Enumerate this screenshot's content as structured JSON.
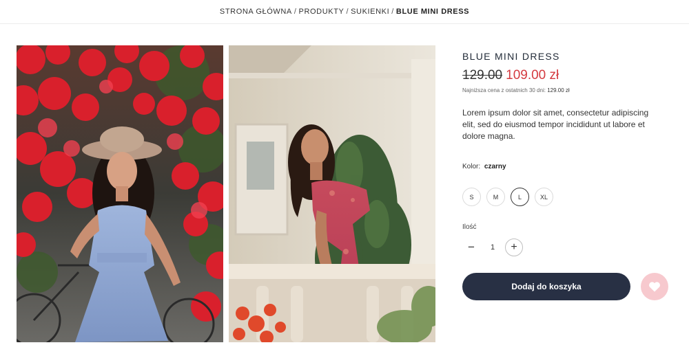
{
  "breadcrumb": {
    "home": "STRONA GŁÓWNA",
    "products": "PRODUKTY",
    "category": "SUKIENKI",
    "current": "BLUE MINI DRESS",
    "separator": "/"
  },
  "gallery": {
    "image1": "woman-in-blue-dress-with-red-flowers",
    "image2": "woman-in-red-floral-dress-on-balcony"
  },
  "product": {
    "title": "BLUE MINI DRESS",
    "old_price": "129.00",
    "new_price": "109.00 zł",
    "lowest_label": "Najniższa cena z ostatnich 30 dni:",
    "lowest_value": "129.00 zł",
    "description": "Lorem ipsum dolor sit amet, consectetur adipiscing elit, sed do eiusmod tempor incididunt ut labore et dolore magna."
  },
  "color": {
    "label": "Kolor:",
    "value": "czarny"
  },
  "sizes": {
    "options": [
      "S",
      "M",
      "L",
      "XL"
    ],
    "selected": "L"
  },
  "quantity": {
    "label": "Ilość",
    "value": "1",
    "minus": "−",
    "plus": "+"
  },
  "actions": {
    "add_to_cart": "Dodaj do koszyka",
    "wishlist_icon": "heart-icon"
  },
  "colors": {
    "button_bg": "#283044",
    "price_red": "#d43a3f",
    "wishlist_bg": "#f7c9ce"
  }
}
